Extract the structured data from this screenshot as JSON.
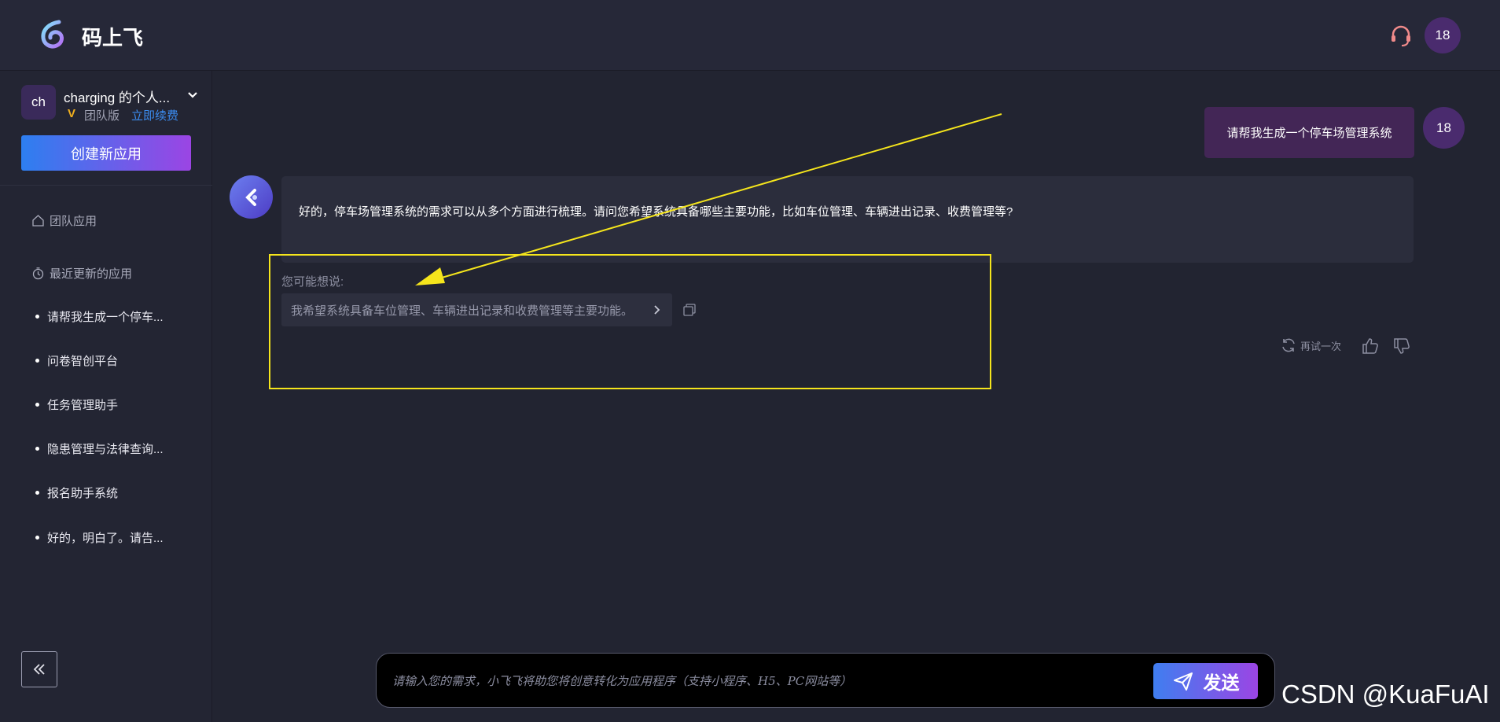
{
  "header": {
    "app_name": "码上飞",
    "user_initials": "18"
  },
  "sidebar": {
    "workspace": {
      "avatar_initials": "ch",
      "name": "charging 的个人...",
      "plan": "团队版",
      "renew_link": "立即续费"
    },
    "create_button": "创建新应用",
    "team_apps_label": "团队应用",
    "recent_label": "最近更新的应用",
    "recent_items": [
      "请帮我生成一个停车...",
      "问卷智创平台",
      "任务管理助手",
      "隐患管理与法律查询...",
      "报名助手系统",
      "好的，明白了。请告..."
    ]
  },
  "chat": {
    "user_message": "请帮我生成一个停车场管理系统",
    "user_initials": "18",
    "bot_message": "好的，停车场管理系统的需求可以从多个方面进行梳理。请问您希望系统具备哪些主要功能，比如车位管理、车辆进出记录、收费管理等?",
    "suggest_label": "您可能想说:",
    "suggestion": "我希望系统具备车位管理、车辆进出记录和收费管理等主要功能。",
    "retry_label": "再试一次"
  },
  "input": {
    "placeholder": "请输入您的需求，小飞飞将助您将创意转化为应用程序（支持小程序、H5、PC网站等）",
    "send_label": "发送"
  },
  "watermark": "CSDN @KuaFuAI",
  "icons": {
    "logo": "logo-icon",
    "support": "headset-icon",
    "chevron": "chevron-down-icon",
    "home": "home-icon",
    "clock": "clock-icon",
    "collapse": "double-chevron-left-icon",
    "copy": "copy-icon",
    "retry": "refresh-icon",
    "like": "thumbs-up-icon",
    "dislike": "thumbs-down-icon",
    "send": "paper-plane-icon"
  },
  "colors": {
    "background": "#222431",
    "accent_gradient_start": "#2d7ff0",
    "accent_gradient_end": "#9b45e4",
    "user_bubble": "#432656",
    "annotation": "#f5e51c",
    "renew_link": "#3b8cf0"
  }
}
